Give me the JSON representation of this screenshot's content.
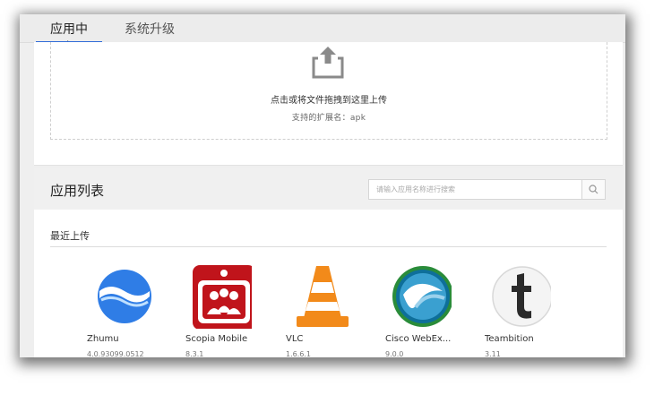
{
  "tabs": [
    {
      "label": "应用中心",
      "active": true
    },
    {
      "label": "系统升级",
      "active": false
    }
  ],
  "upload": {
    "text": "点击或将文件拖拽到这里上传",
    "hint": "支持的扩展名：apk"
  },
  "app_list": {
    "title": "应用列表",
    "search_placeholder": "请输入应用名称进行搜索",
    "section_title": "最近上传",
    "apps": [
      {
        "name": "Zhumu",
        "version": "4.0.93099.0512",
        "icon": "zhumu-icon"
      },
      {
        "name": "Scopia Mobile",
        "version": "8.3.1",
        "icon": "scopia-icon"
      },
      {
        "name": "VLC",
        "version": "1.6.6.1",
        "icon": "vlc-icon"
      },
      {
        "name": "Cisco WebEx...",
        "version": "9.0.0",
        "icon": "webex-icon"
      },
      {
        "name": "Teambition",
        "version": "3.11",
        "icon": "teambition-icon"
      }
    ]
  },
  "colors": {
    "accent": "#2f6bd8",
    "scopia_red": "#c0141b",
    "vlc_orange": "#f28a1a"
  }
}
